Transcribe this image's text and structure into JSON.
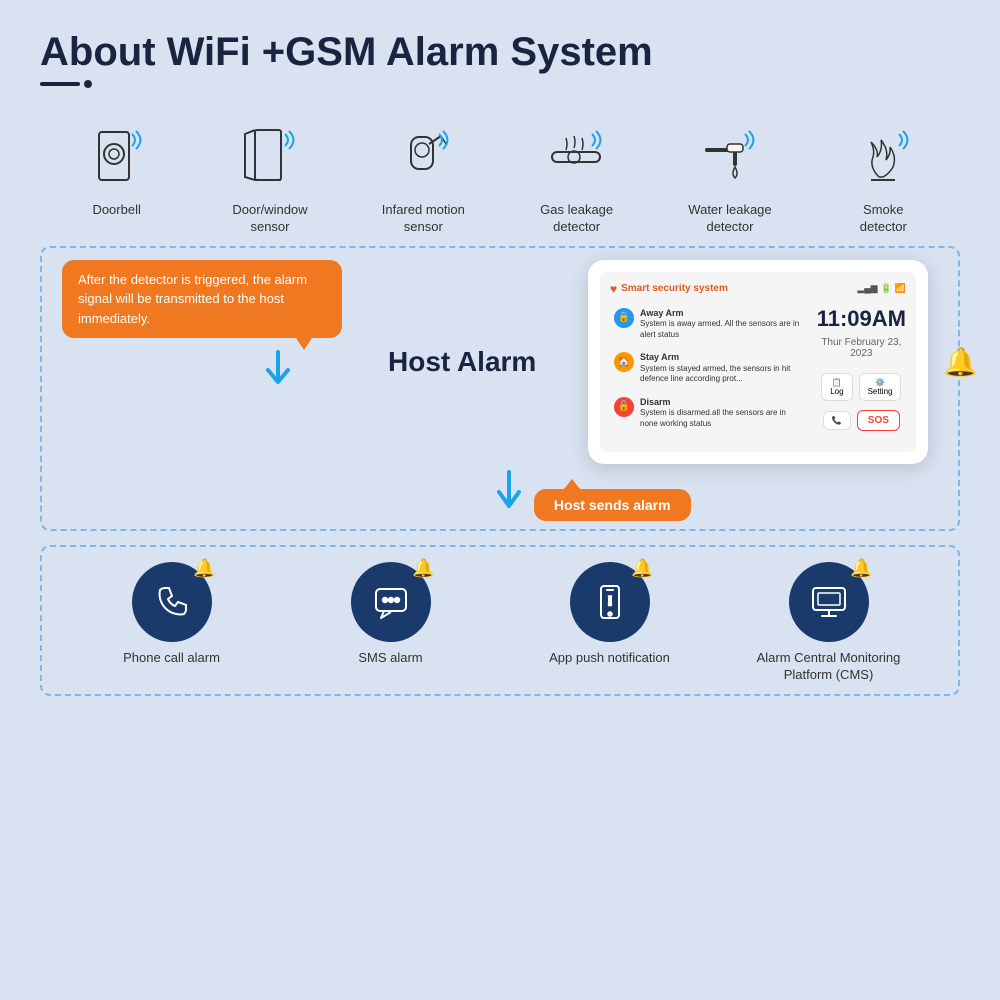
{
  "title": "About WiFi +GSM Alarm System",
  "top_icons": [
    {
      "id": "doorbell",
      "label": "Doorbell",
      "type": "doorbell"
    },
    {
      "id": "door-window",
      "label": "Door/window\nsensor",
      "type": "door"
    },
    {
      "id": "motion",
      "label": "Infared motion\nsensor",
      "type": "motion"
    },
    {
      "id": "gas",
      "label": "Gas leakage\ndetector",
      "type": "gas"
    },
    {
      "id": "water",
      "label": "Water leakage\ndetector",
      "type": "water"
    },
    {
      "id": "smoke",
      "label": "Smoke\ndetector",
      "type": "smoke"
    }
  ],
  "speech_bubble": "After the detector is triggered, the alarm signal will be transmitted to the host immediately.",
  "host_alarm_label": "Host Alarm",
  "device": {
    "brand": "Smart security system",
    "time": "11:09AM",
    "date": "Thur February 23, 2023",
    "away_arm": {
      "title": "Away Arm",
      "desc": "System is away armed. All the sensors are in alert status"
    },
    "stay_arm": {
      "title": "Stay Arm",
      "desc": "System is stayed armed, the sensors in hit defence line according prot..."
    },
    "disarm": {
      "title": "Disarm",
      "desc": "System is disarmed.all the sensors are in none working status"
    },
    "log_label": "Log",
    "setting_label": "Setting",
    "sos_label": "SOS"
  },
  "host_bubble": "Host sends alarm",
  "bottom_icons": [
    {
      "id": "phone",
      "label": "Phone call alarm",
      "type": "phone"
    },
    {
      "id": "sms",
      "label": "SMS alarm",
      "type": "sms"
    },
    {
      "id": "app",
      "label": "App push notification",
      "type": "app"
    },
    {
      "id": "cms",
      "label": "Alarm Central Monitoring\nPlatform (CMS)",
      "type": "monitor"
    }
  ]
}
